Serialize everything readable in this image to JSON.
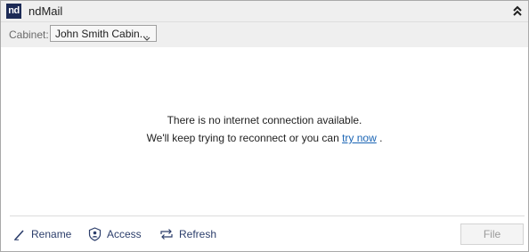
{
  "titlebar": {
    "logo_text": "nd",
    "app_title": "ndMail",
    "collapse_icon": "double-chevron-up-icon"
  },
  "cabinet": {
    "label": "Cabinet:",
    "selected": "John Smith Cabin...",
    "dropdown_icon": "chevron-down-icon"
  },
  "message": {
    "line1": "There is no internet connection available.",
    "line2_prefix": "We'll keep trying to reconnect or you can ",
    "link": "try now",
    "line2_suffix": " ."
  },
  "actions": {
    "rename": {
      "label": "Rename",
      "icon": "pencil-icon"
    },
    "access": {
      "label": "Access",
      "icon": "shield-user-icon"
    },
    "refresh": {
      "label": "Refresh",
      "icon": "refresh-arrows-icon"
    }
  },
  "file_button": {
    "label": "File",
    "enabled": false
  },
  "colors": {
    "logo_bg": "#1d2b56",
    "link": "#1a64b4",
    "action_text": "#2c3e6b",
    "disabled_text": "#9a9a9a"
  }
}
